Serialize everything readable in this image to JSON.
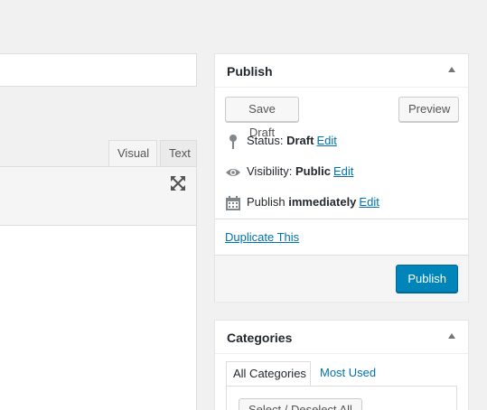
{
  "editor": {
    "tabs": [
      {
        "label": "Visual"
      },
      {
        "label": "Text"
      }
    ],
    "fullscreen_icon": "fullscreen-icon"
  },
  "publish": {
    "title": "Publish",
    "save_draft_label": "Save Draft",
    "preview_label": "Preview",
    "status_label": "Status:",
    "status_value": "Draft",
    "status_edit": "Edit",
    "visibility_label": "Visibility:",
    "visibility_value": "Public",
    "visibility_edit": "Edit",
    "publish_label": "Publish",
    "publish_value": "immediately",
    "publish_edit": "Edit",
    "duplicate_label": "Duplicate This",
    "publish_button_label": "Publish",
    "icons": {
      "status": "pin-icon",
      "visibility": "eye-icon",
      "schedule": "calendar-icon"
    }
  },
  "categories": {
    "title": "Categories",
    "tab_all": "All Categories",
    "tab_most_used": "Most Used",
    "select_button": "Select / Deselect All"
  },
  "colors": {
    "link": "#0073aa",
    "primary_button": "#0085ba",
    "background": "#f1f1f1"
  }
}
